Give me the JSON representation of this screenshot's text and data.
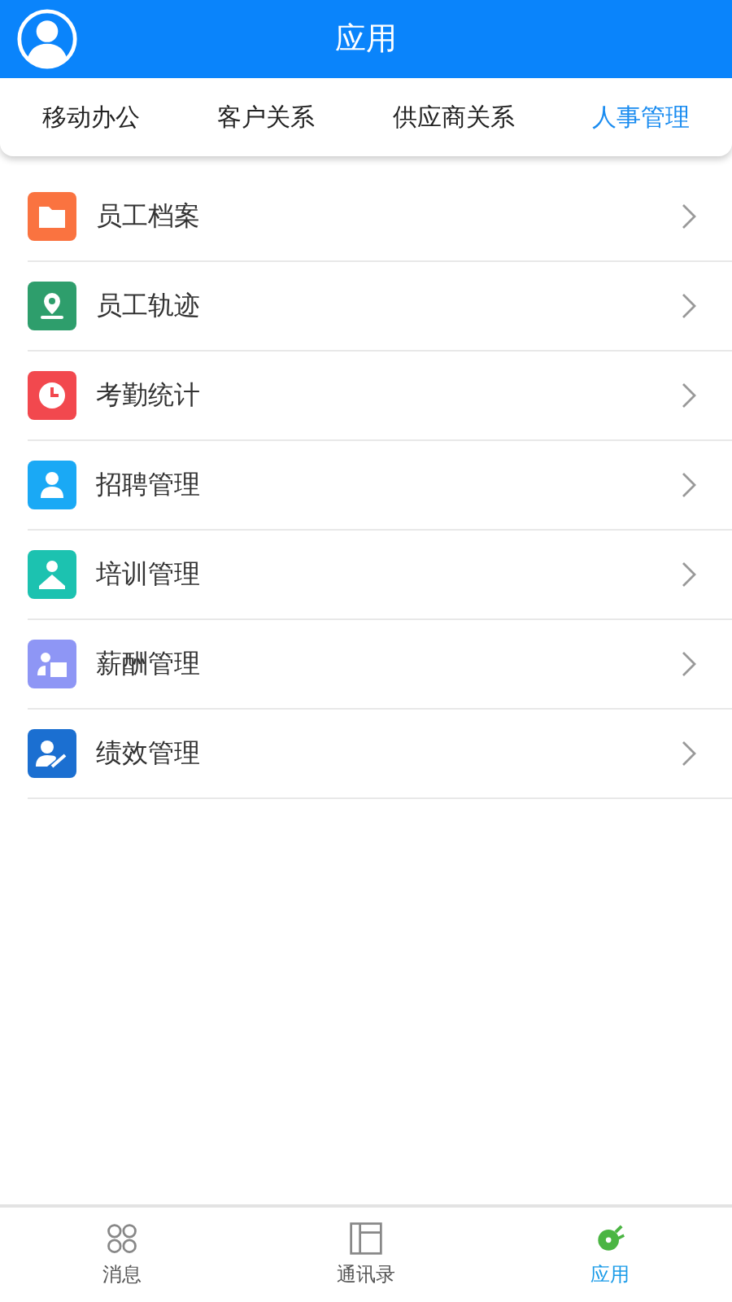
{
  "header": {
    "title": "应用"
  },
  "tabs": [
    {
      "label": "移动办公",
      "selected": false
    },
    {
      "label": "客户关系",
      "selected": false
    },
    {
      "label": "供应商关系",
      "selected": false
    },
    {
      "label": "人事管理",
      "selected": true
    }
  ],
  "items": [
    {
      "label": "员工档案",
      "color": "#fa7340",
      "kind": "folder"
    },
    {
      "label": "员工轨迹",
      "color": "#2e9e6c",
      "kind": "pin"
    },
    {
      "label": "考勤统计",
      "color": "#f2484e",
      "kind": "clock"
    },
    {
      "label": "招聘管理",
      "color": "#1aa9f5",
      "kind": "person"
    },
    {
      "label": "培训管理",
      "color": "#1cc2b0",
      "kind": "reader"
    },
    {
      "label": "薪酬管理",
      "color": "#8e96f5",
      "kind": "gift"
    },
    {
      "label": "绩效管理",
      "color": "#1b6fd1",
      "kind": "growth"
    }
  ],
  "nav": [
    {
      "label": "消息",
      "selected": false,
      "kind": "circles"
    },
    {
      "label": "通讯录",
      "selected": false,
      "kind": "book"
    },
    {
      "label": "应用",
      "selected": true,
      "kind": "plug"
    }
  ]
}
